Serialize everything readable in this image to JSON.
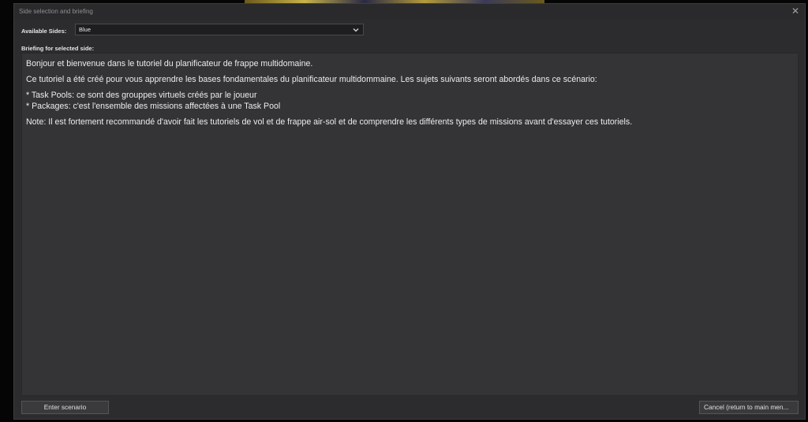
{
  "window": {
    "title": "Side selection and briefing",
    "close_glyph": "✕",
    "close_icon": "close-icon"
  },
  "sides": {
    "label": "Available Sides:",
    "selected": "Blue",
    "dropdown_icon": "chevron-down-icon"
  },
  "briefing": {
    "label": "Briefing for selected side:",
    "paragraphs": [
      "Bonjour et bienvenue dans le tutoriel du planificateur de frappe multidomaine.",
      "Ce tutoriel a été créé pour vous apprendre les bases fondamentales du planificateur multidommaine. Les sujets suivants seront abordés dans ce scénario:"
    ],
    "bullets": [
      "* Task Pools: ce sont des grouppes virtuels créés par le joueur",
      "* Packages: c'est l'ensemble des missions affectées à une Task Pool"
    ],
    "note": "Note: Il est fortement recommandé d'avoir fait les tutoriels de vol et de frappe air-sol et de comprendre les différents types de missions avant d'essayer ces tutoriels."
  },
  "buttons": {
    "enter": "Enter scenario",
    "cancel": "Cancel (return to main men..."
  }
}
